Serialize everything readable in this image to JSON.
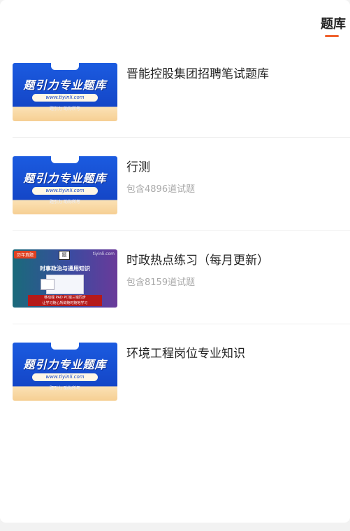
{
  "tabs": {
    "active_label": "题库"
  },
  "banner": {
    "headline": "题引力专业题库",
    "url": "www.tiyinli.com",
    "tagline": "题引力 助你所考",
    "brand_badge": "题引力"
  },
  "practice_banner": {
    "tag": "历年真题",
    "site": "tiyinli.com",
    "heading": "时事政治与通用知识",
    "bar_line1": "移动端 PAD PC端三端同步",
    "bar_line2": "让学习随心所欲随时随地学习"
  },
  "items": [
    {
      "title": "晋能控股集团招聘笔试题库",
      "meta": ""
    },
    {
      "title": "行测",
      "meta": "包含4896道试题"
    },
    {
      "title": "时政热点练习（每月更新）",
      "meta": "包含8159道试题"
    },
    {
      "title": "环境工程岗位专业知识",
      "meta": ""
    }
  ],
  "colors": {
    "accent": "#f0612d",
    "banner_blue": "#1446c7"
  }
}
